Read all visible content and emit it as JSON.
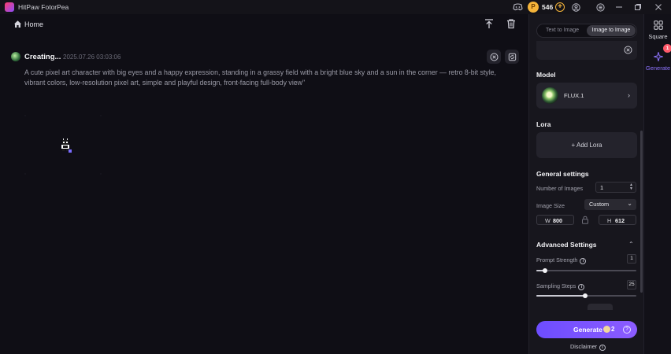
{
  "titlebar": {
    "app_name": "HitPaw FotorPea",
    "coin_glyph": "P",
    "coins": "546",
    "coin_plus": "+"
  },
  "header": {
    "home_label": "Home"
  },
  "task": {
    "status": "Creating...",
    "timestamp": "2025.07.26  03:03:06",
    "prompt": "A cute pixel art character with big eyes and a happy expression, standing in a grassy field with a bright blue sky and a sun in the corner — retro 8-bit style, vibrant colors, low-resolution pixel art, simple and playful design, front-facing full-body view\""
  },
  "panel": {
    "tabs": [
      {
        "label": "Text to Image",
        "active": false
      },
      {
        "label": "Image to Image",
        "active": true
      }
    ],
    "model_title": "Model",
    "model_name": "FLUX.1",
    "chevron_right": "›",
    "lora_title": "Lora",
    "add_lora_label": "+ Add Lora",
    "general_title": "General settings",
    "number_of_images_label": "Number of Images",
    "number_of_images_value": "1",
    "stepper_up": "▲",
    "stepper_down": "▼",
    "image_size_label": "Image Size",
    "image_size_value": "Custom",
    "select_chevron": "⌄",
    "width_letter": "W",
    "width_value": "800",
    "height_letter": "H",
    "height_value": "612",
    "advanced_title": "Advanced Settings",
    "collapse_chevron": "⌃",
    "info_glyph": "i",
    "prompt_strength_label": "Prompt Strength",
    "prompt_strength_value": "1",
    "prompt_strength_fraction": 0.09,
    "sampling_steps_label": "Sampling Steps",
    "sampling_steps_value": "25",
    "sampling_steps_fraction": 0.49,
    "generate_label": "Generate",
    "generate_cost": "2",
    "generate_help": "?",
    "disclaimer_label": "Disclaimer"
  },
  "rail": {
    "square_label": "Square",
    "generate_label": "Generate",
    "badge_count": "1"
  },
  "colors": {
    "accent": "#7b56ff",
    "coin": "#f5b43a",
    "badge": "#ff5a6b"
  },
  "icons": [
    "app-logo",
    "discord-icon",
    "coin-icon",
    "add-coin-icon",
    "user-icon",
    "settings-icon",
    "minimize-icon",
    "maximize-icon",
    "close-icon",
    "home-icon",
    "upload-icon",
    "trash-icon",
    "cancel-icon",
    "retry-icon",
    "clear-icon",
    "lock-icon",
    "info-icon",
    "square-grid-icon",
    "sparkle-icon"
  ]
}
